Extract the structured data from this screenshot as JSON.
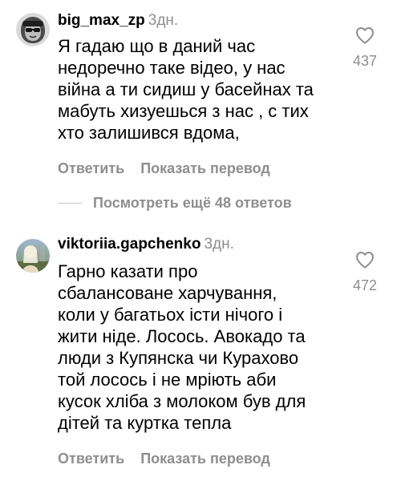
{
  "comments": [
    {
      "username": "big_max_zp",
      "time": "3дн.",
      "lines": [
        "Я гадаю що в даний час",
        "недоречно таке відео, у нас",
        "війна а ти сидиш у басейнах та",
        "мабуть хизуешься з нас , с тих",
        "хто залишився вдома,"
      ],
      "likes": "437",
      "reply_label": "Ответить",
      "translate_label": "Показать перевод"
    },
    {
      "username": "viktoriia.gapchenko",
      "time": "3дн.",
      "lines": [
        "Гарно казати про",
        "сбалансоване харчування,",
        "коли у багатьох істи нічого і",
        "жити ніде. Лосось. Авокадо та",
        "люди з Купянска чи Курахово",
        "той лосось і не мріють аби",
        "кусок хліба з молоком був для",
        "дітей та куртка тепла"
      ],
      "likes": "472",
      "reply_label": "Ответить",
      "translate_label": "Показать перевод"
    }
  ],
  "view_more_replies": "Посмотреть ещё 48 ответов",
  "icons": {
    "like": "heart-outline-icon"
  },
  "colors": {
    "text": "#000000",
    "secondary": "#8e8e8e",
    "background": "#ffffff"
  }
}
